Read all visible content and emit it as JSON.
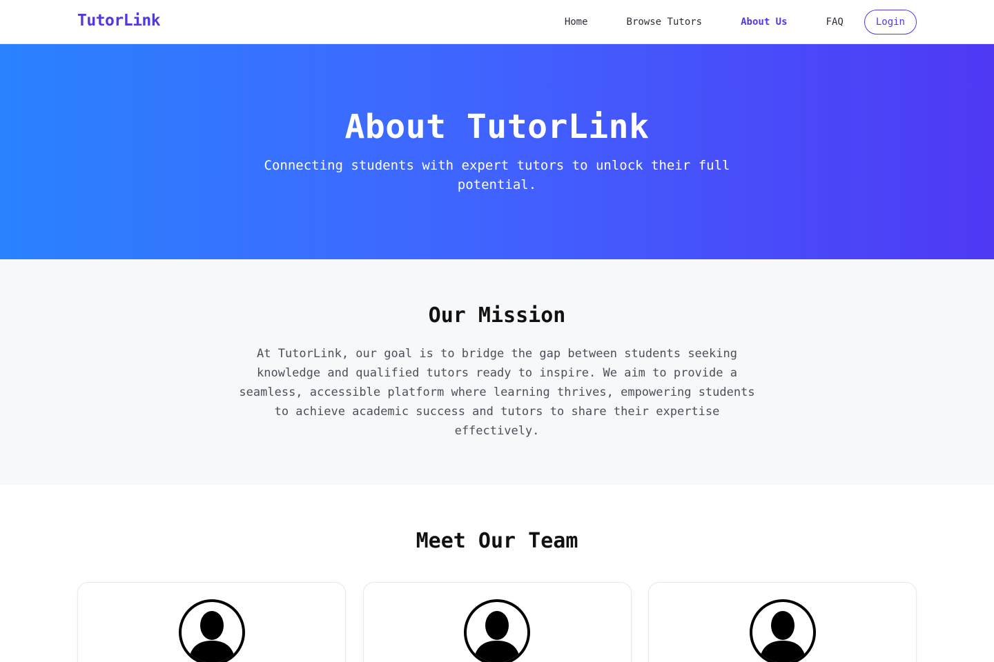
{
  "header": {
    "brand": "TutorLink",
    "nav": {
      "home": "Home",
      "browse": "Browse Tutors",
      "about": "About Us",
      "faq": "FAQ"
    },
    "login": "Login"
  },
  "hero": {
    "title": "About TutorLink",
    "subtitle": "Connecting students with expert tutors to unlock their full potential."
  },
  "mission": {
    "title": "Our Mission",
    "body": "At TutorLink, our goal is to bridge the gap between students seeking knowledge and qualified tutors ready to inspire. We aim to provide a seamless, accessible platform where learning thrives, empowering students to achieve academic success and tutors to share their expertise effectively."
  },
  "team": {
    "title": "Meet Our Team",
    "members_icon": "user-silhouette-icon"
  },
  "colors": {
    "brand": "#4f39e6",
    "hero_start": "#2a82ff",
    "hero_end": "#4f39f5",
    "mission_bg": "#f7f8fa"
  }
}
